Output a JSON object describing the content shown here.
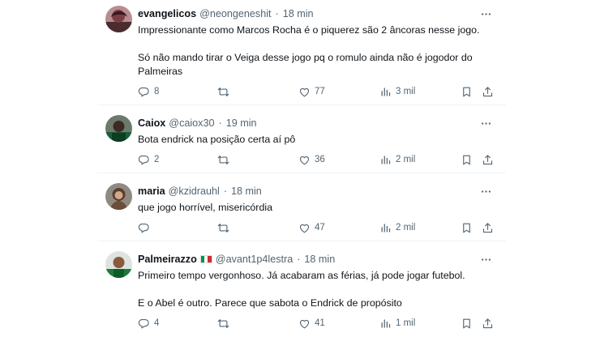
{
  "tweets": [
    {
      "name": "evangelicos",
      "handle": "@neongeneshit",
      "time": "18 min",
      "lines": [
        "Impressionante como Marcos Rocha é o piquerez são 2 âncoras nesse jogo.",
        "Só não mando tirar o Veiga desse jogo pq o romulo ainda não é jogodor do",
        "Palmeiras"
      ],
      "replies": "8",
      "retweets": "",
      "likes": "77",
      "views": "3 mil"
    },
    {
      "name": "Caiox",
      "handle": "@caiox30",
      "time": "19 min",
      "lines": [
        "Bota endrick na posição certa aí pô"
      ],
      "replies": "2",
      "retweets": "",
      "likes": "36",
      "views": "2 mil"
    },
    {
      "name": "maria",
      "handle": "@kzidrauhl",
      "time": "18 min",
      "lines": [
        "que jogo horrível, misericórdia"
      ],
      "replies": "",
      "retweets": "",
      "likes": "47",
      "views": "2 mil"
    },
    {
      "name": "Palmeirazzo",
      "flag": "italy-flag",
      "handle": "@avant1p4lestra",
      "time": "18 min",
      "lines": [
        "Primeiro tempo vergonhoso. Já acabaram as férias, já pode jogar futebol.",
        "E o Abel é outro. Parece que sabota o Endrick de propósito"
      ],
      "replies": "4",
      "retweets": "",
      "likes": "41",
      "views": "1 mil"
    }
  ],
  "separator": "·",
  "more_icon": "more-dots-icon",
  "colors": {
    "text": "#0f1419",
    "muted": "#536471",
    "divider": "#eff3f4"
  }
}
